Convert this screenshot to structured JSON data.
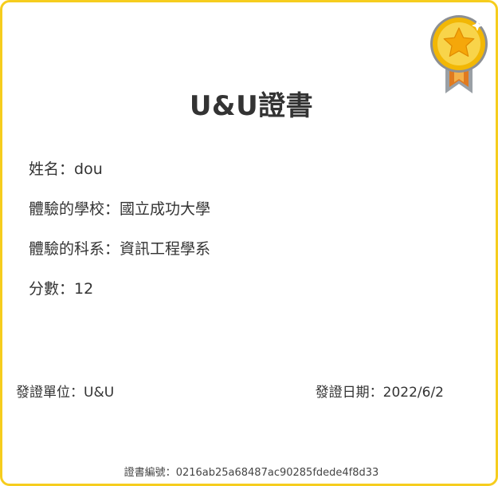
{
  "certificate": {
    "title": "U&U證書",
    "fields": [
      {
        "label": "姓名：",
        "value": "dou"
      },
      {
        "label": "體驗的學校：",
        "value": "國立成功大學"
      },
      {
        "label": "體驗的科系：",
        "value": "資訊工程學系"
      },
      {
        "label": "分數：",
        "value": "12"
      }
    ],
    "issuer": {
      "label": "發證單位：",
      "value": "U&U"
    },
    "issue_date": {
      "label": "發證日期：",
      "value": "2022/6/2"
    },
    "serial": {
      "label": "證書編號：",
      "value": "0216ab25a68487ac90285fdede4f8d33"
    }
  },
  "badge": {
    "icon": "star-medal-icon"
  },
  "colors": {
    "border": "#f6cd1e",
    "medal_gold": "#f5c518",
    "medal_ribbon": "#e07a1f",
    "text": "#333333"
  }
}
